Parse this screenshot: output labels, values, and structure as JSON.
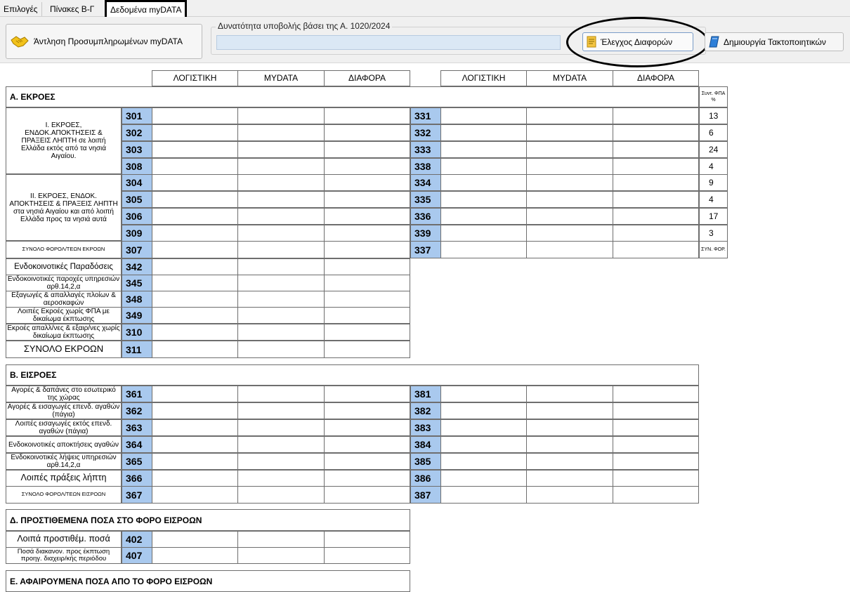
{
  "tabs": [
    "Επιλογές",
    "Πίνακες Β-Γ",
    "Δεδομένα myDATA"
  ],
  "toolbar": {
    "fetch_button": "Άντληση Προσυμπληρωμένων myDATA",
    "group_title": "Δυνατότητα υποβολής βάσει της Α. 1020/2024",
    "check_button": "Έλεγχος Διαφορών",
    "create_button": "Δημιουργία Τακτοποιητικών"
  },
  "columns": [
    "ΛΟΓΙΣΤΙΚΗ",
    "ΜΥDATA",
    "ΔΙΑΦΟΡΑ"
  ],
  "section_a": {
    "title": "Α. ΕΚΡΟΕΣ",
    "rate_header": "Συντ. ΦΠΑ %",
    "group1_label": "Ι. ΕΚΡΟΕΣ, ΕΝΔΟΚ.ΑΠΟΚΤΗΣΕΙΣ & ΠΡΑΞΕΙΣ ΛΗΠΤΗ σε λοιπή Ελλάδα εκτός από τα νησιά Αιγαίου.",
    "group2_label": "ΙΙ. ΕΚΡΟΕΣ, ΕΝΔΟΚ. ΑΠΟΚΤΗΣΕΙΣ & ΠΡΑΞΕΙΣ ΛΗΠΤΗ στα νησιά Αιγαίου και από λοιπή Ελλάδα προς τα νησιά αυτά",
    "rows": [
      {
        "left": "301",
        "right": "331",
        "rate": "13"
      },
      {
        "left": "302",
        "right": "332",
        "rate": "6"
      },
      {
        "left": "303",
        "right": "333",
        "rate": "24"
      },
      {
        "left": "308",
        "right": "338",
        "rate": "4"
      },
      {
        "left": "304",
        "right": "334",
        "rate": "9"
      },
      {
        "left": "305",
        "right": "335",
        "rate": "4"
      },
      {
        "left": "306",
        "right": "336",
        "rate": "17"
      },
      {
        "left": "309",
        "right": "339",
        "rate": "3"
      }
    ],
    "total": {
      "label": "ΣΥΝΟΛΟ ΦΟΡΟΛ/ΤΕΩΝ ΕΚΡΟΩΝ",
      "left": "307",
      "right": "337",
      "rate": "ΣΥΝ. ΦΟΡ."
    },
    "extra": [
      {
        "label": "Ενδοκοινοτικές Παραδόσεις",
        "code": "342"
      },
      {
        "label": "Ενδοκοινοτικές παροχές υπηρεσιών αρθ.14,2,α",
        "code": "345"
      },
      {
        "label": "Εξαγωγές & απαλλαγές πλοίων & αεροσκαφών",
        "code": "348"
      },
      {
        "label": "Λοιπές Εκροές χωρίς ΦΠΑ με δικαίωμα έκπτωσης",
        "code": "349"
      },
      {
        "label": "Εκροές απαλλ/νες & εξαιρ/νες χωρίς δικαίωμα έκπτωσης",
        "code": "310"
      },
      {
        "label": "ΣΥΝΟΛΟ ΕΚΡΟΩΝ",
        "code": "311"
      }
    ]
  },
  "section_b": {
    "title": "Β. ΕΙΣΡΟΕΣ",
    "rows": [
      {
        "label": "Αγορές & δαπάνες στο εσωτερικό της χώρας",
        "left": "361",
        "right": "381"
      },
      {
        "label": "Αγορές & εισαγωγές επενδ. αγαθών (πάγια)",
        "left": "362",
        "right": "382"
      },
      {
        "label": "Λοιπές εισαγωγές εκτός επενδ. αγαθών (πάγια)",
        "left": "363",
        "right": "383"
      },
      {
        "label": "Ενδοκοινοτικές αποκτήσεις αγαθών",
        "left": "364",
        "right": "384"
      },
      {
        "label": "Ενδοκοινοτικές λήψεις υπηρεσιών αρθ.14,2,α",
        "left": "365",
        "right": "385"
      },
      {
        "label": "Λοιπές πράξεις λήπτη",
        "left": "366",
        "right": "386"
      },
      {
        "label": "ΣΥΝΟΛΟ ΦΟΡΟΛ/ΤΕΩΝ ΕΙΣΡΟΩΝ",
        "left": "367",
        "right": "387"
      }
    ]
  },
  "section_d": {
    "title": "Δ. ΠΡΟΣΤΙΘΕΜΕΝΑ ΠΟΣΑ ΣΤΟ ΦΟΡΟ ΕΙΣΡΟΩΝ",
    "rows": [
      {
        "label": "Λοιπά προστιθέμ. ποσά",
        "code": "402"
      },
      {
        "label": "Ποσά διακανον. προς έκπτωση προηγ. διαχειρ/κής περιόδου",
        "code": "407"
      }
    ]
  },
  "section_e": {
    "title": "Ε. ΑΦΑΙΡΟΥΜΕΝΑ ΠΟΣΑ ΑΠΟ ΤΟ ΦΟΡΟ ΕΙΣΡΟΩΝ"
  }
}
